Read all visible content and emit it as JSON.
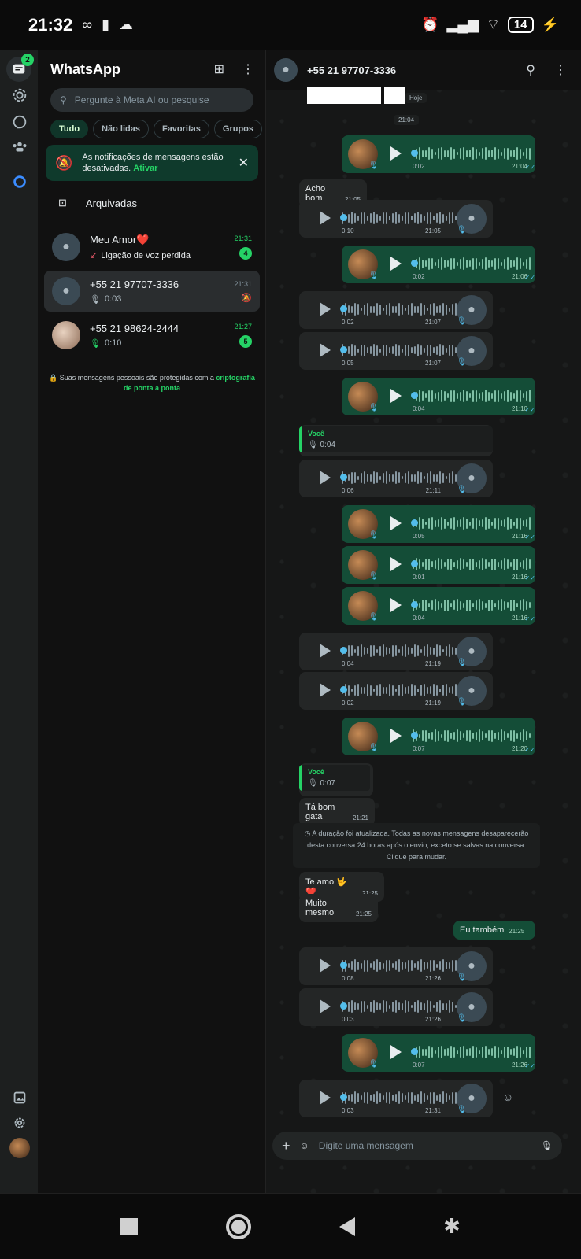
{
  "status": {
    "time": "21:32",
    "battery": "14"
  },
  "app": {
    "title": "WhatsApp",
    "rail_badge": "2"
  },
  "search": {
    "placeholder": "Pergunte à Meta AI ou pesquise"
  },
  "chips": [
    "Tudo",
    "Não lidas",
    "Favoritas",
    "Grupos"
  ],
  "notice": {
    "text": "As notificações de mensagens estão desativadas.",
    "link": "Ativar"
  },
  "archived": "Arquivadas",
  "chats": [
    {
      "name": "Meu Amor❤️",
      "sub": "Ligação de voz perdida",
      "time": "21:31",
      "unread": "4"
    },
    {
      "name": "+55 21 97707-3336",
      "sub": "0:03",
      "time": "21:31"
    },
    {
      "name": "+55 21 98624-2444",
      "sub": "0:10",
      "time": "21:27",
      "unread": "5"
    }
  ],
  "e2e": {
    "text": "Suas mensagens pessoais são protegidas com a",
    "link": "criptografia de ponta a ponta"
  },
  "conversation": {
    "contact": "+55 21 97707-3336",
    "day": "Hoje",
    "first_time": "21:04",
    "messages": [
      {
        "dir": "out",
        "kind": "voice",
        "dur": "0:02",
        "time": "21:04"
      },
      {
        "dir": "in",
        "kind": "text",
        "text": "Acho bom",
        "time": "21:05"
      },
      {
        "dir": "in",
        "kind": "voice",
        "dur": "0:10",
        "time": "21:05"
      },
      {
        "dir": "out",
        "kind": "voice",
        "dur": "0:02",
        "time": "21:06"
      },
      {
        "dir": "in",
        "kind": "voice",
        "dur": "0:02",
        "time": "21:07"
      },
      {
        "dir": "in",
        "kind": "voice",
        "dur": "0:05",
        "time": "21:07"
      },
      {
        "dir": "out",
        "kind": "voice",
        "dur": "0:04",
        "time": "21:10"
      },
      {
        "dir": "in",
        "kind": "reply",
        "who": "Você",
        "quoted": "0:04"
      },
      {
        "dir": "in",
        "kind": "voice",
        "dur": "0:06",
        "time": "21:11"
      },
      {
        "dir": "out",
        "kind": "voice",
        "dur": "0:05",
        "time": "21:16"
      },
      {
        "dir": "out",
        "kind": "voice",
        "dur": "0:01",
        "time": "21:16"
      },
      {
        "dir": "out",
        "kind": "voice",
        "dur": "0:04",
        "time": "21:16"
      },
      {
        "dir": "in",
        "kind": "voice",
        "dur": "0:04",
        "time": "21:19"
      },
      {
        "dir": "in",
        "kind": "voice",
        "dur": "0:02",
        "time": "21:19"
      },
      {
        "dir": "out",
        "kind": "voice",
        "dur": "0:07",
        "time": "21:20"
      },
      {
        "dir": "in",
        "kind": "reply",
        "who": "Você",
        "quoted": "0:07"
      },
      {
        "dir": "in",
        "kind": "text",
        "text": "Tá bom gata",
        "time": "21:21"
      },
      {
        "dir": "in",
        "kind": "text",
        "text": "Te amo 🤟 ❤️",
        "time": "21:25"
      },
      {
        "dir": "in",
        "kind": "text",
        "text": "Muito mesmo",
        "time": "21:25"
      },
      {
        "dir": "out",
        "kind": "text",
        "text": "Eu também",
        "time": "21:25"
      },
      {
        "dir": "in",
        "kind": "voice",
        "dur": "0:08",
        "time": "21:26"
      },
      {
        "dir": "in",
        "kind": "voice",
        "dur": "0:03",
        "time": "21:26"
      },
      {
        "dir": "out",
        "kind": "voice",
        "dur": "0:07",
        "time": "21:26"
      },
      {
        "dir": "in",
        "kind": "voice",
        "dur": "0:03",
        "time": "21:31"
      }
    ],
    "system": "A duração foi atualizada. Todas as novas mensagens desaparecerão desta conversa 24 horas após o envio, exceto se salvas na conversa. Clique para mudar."
  },
  "composer": {
    "placeholder": "Digite uma mensagem"
  }
}
